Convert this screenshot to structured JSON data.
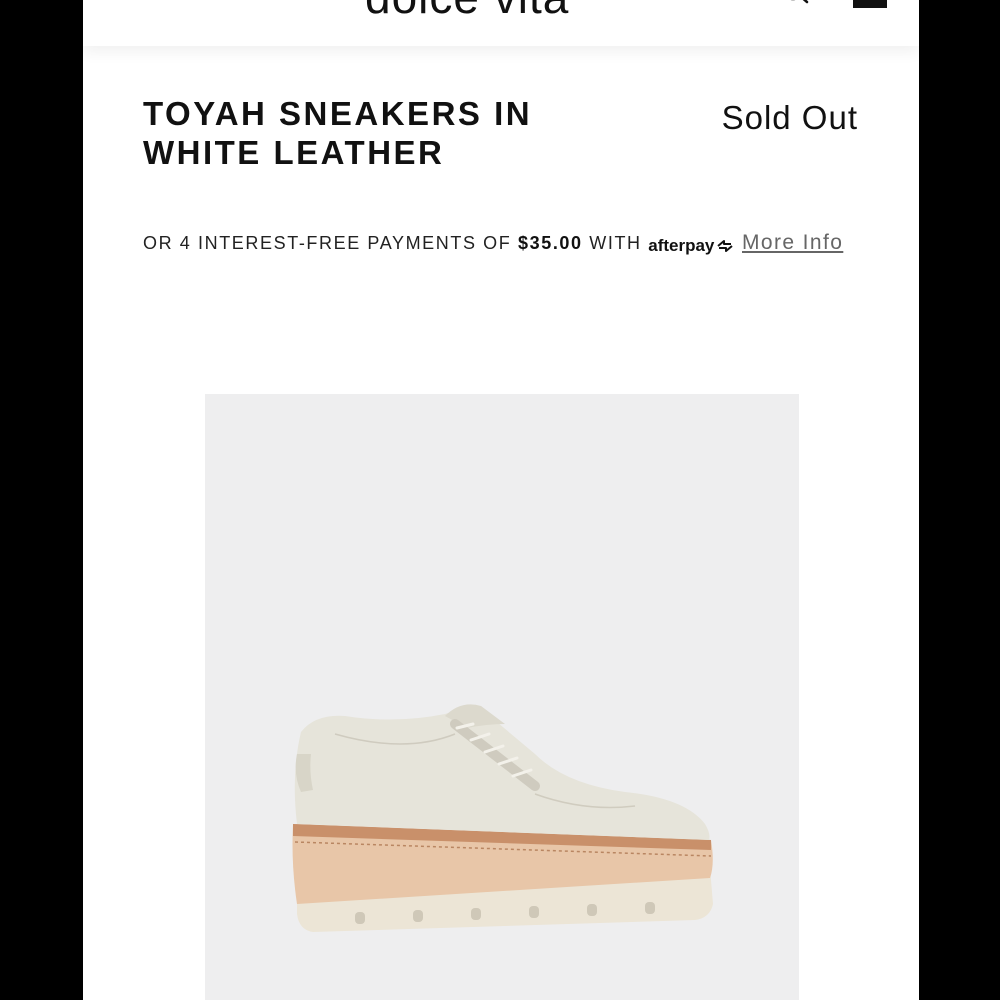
{
  "header": {
    "brand": "dolce vita",
    "search_icon": "search-icon",
    "bag_icon": "shopping-bag-icon"
  },
  "product": {
    "title": "TOYAH SNEAKERS IN WHITE LEATHER",
    "status": "Sold Out"
  },
  "afterpay": {
    "prefix": "OR 4 INTEREST-FREE PAYMENTS OF",
    "amount": "$35.00",
    "with": "WITH",
    "logo_text": "afterpay",
    "more_info": "More Info"
  },
  "image": {
    "icon": "sneaker-product-image",
    "background": "#eeeeef",
    "upper_color": "#e6e4da",
    "sole_color": "#e8c6a8",
    "outsole_color": "#ece5d6"
  }
}
